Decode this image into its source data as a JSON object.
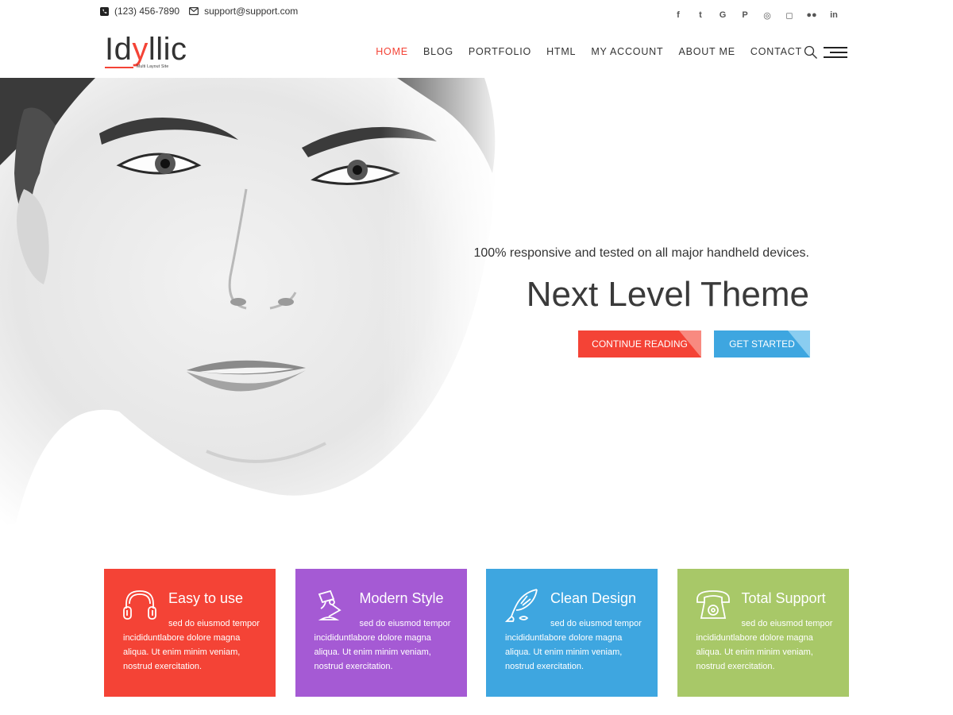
{
  "topbar": {
    "phone": "(123) 456-7890",
    "email": "support@support.com",
    "social": [
      {
        "icon": "facebook-icon",
        "glyph": "f"
      },
      {
        "icon": "twitter-icon",
        "glyph": "t"
      },
      {
        "icon": "google-plus-icon",
        "glyph": "G"
      },
      {
        "icon": "pinterest-icon",
        "glyph": "P"
      },
      {
        "icon": "dribbble-icon",
        "glyph": "◎"
      },
      {
        "icon": "instagram-icon",
        "glyph": "◻"
      },
      {
        "icon": "flickr-icon",
        "glyph": "●●"
      },
      {
        "icon": "linkedin-icon",
        "glyph": "in"
      }
    ]
  },
  "logo": {
    "text_a": "Id",
    "text_y": "y",
    "text_b": "llic",
    "tagline": "Multi Layout Site"
  },
  "nav": {
    "items": [
      "HOME",
      "BLOG",
      "PORTFOLIO",
      "HTML",
      "MY ACCOUNT",
      "ABOUT ME",
      "CONTACT"
    ],
    "active_index": 0
  },
  "hero": {
    "subtitle": "100% responsive and tested on all major handheld devices.",
    "title": "Next Level Theme",
    "primary_button": "CONTINUE READING",
    "secondary_button": "GET STARTED"
  },
  "features": [
    {
      "title": "Easy to use",
      "icon": "headphones-icon",
      "color": "#f44336",
      "text": "sed do eiusmod tempor incididuntlabore dolore magna aliqua. Ut enim minim veniam, nostrud exercitation."
    },
    {
      "title": "Modern Style",
      "icon": "desk-lamp-icon",
      "color": "#a55ad4",
      "text": "sed do eiusmod tempor incididuntlabore dolore magna aliqua. Ut enim minim veniam, nostrud exercitation."
    },
    {
      "title": "Clean Design",
      "icon": "quill-pen-icon",
      "color": "#3ea6e0",
      "text": "sed do eiusmod tempor incididuntlabore dolore magna aliqua. Ut enim minim veniam, nostrud exercitation."
    },
    {
      "title": "Total Support",
      "icon": "telephone-icon",
      "color": "#a8c868",
      "text": "sed do eiusmod tempor incididuntlabore dolore magna aliqua. Ut enim minim veniam, nostrud exercitation."
    }
  ],
  "colors": {
    "accent": "#f44336",
    "blue": "#3ea6e0",
    "purple": "#a55ad4",
    "green": "#a8c868"
  }
}
